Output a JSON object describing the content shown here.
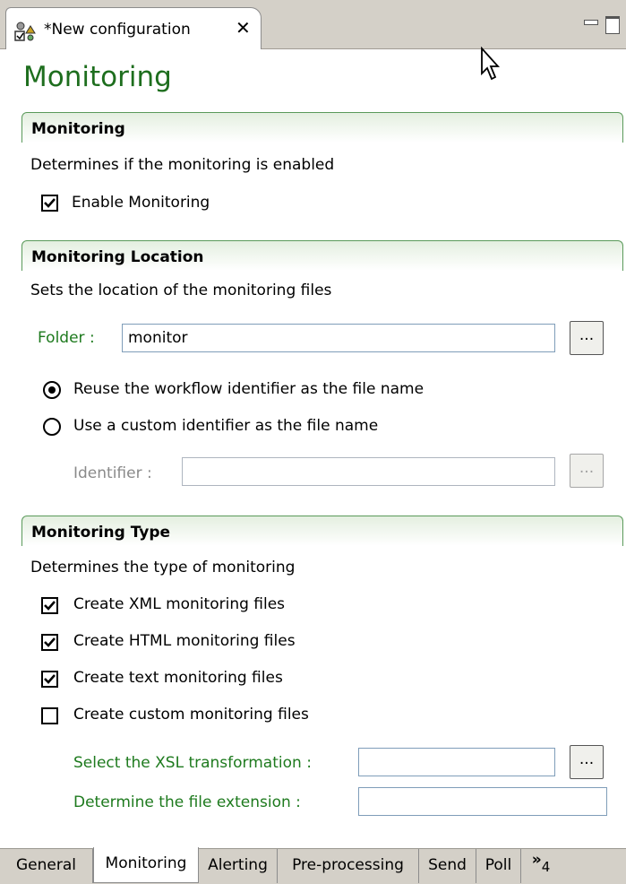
{
  "editor_tab": {
    "title": "*New configuration",
    "close": "✕"
  },
  "page": {
    "title": "Monitoring"
  },
  "monitoring": {
    "header": "Monitoring",
    "description": "Determines if the monitoring is enabled",
    "enable_label": "Enable Monitoring",
    "enable_checked": true
  },
  "location": {
    "header": "Monitoring Location",
    "description": "Sets the location of the monitoring files",
    "folder_label": "Folder :",
    "folder_value": "monitor",
    "browse": "...",
    "radio_reuse": "Reuse the workflow identifier as the file name",
    "radio_custom": "Use a custom identifier as the file name",
    "identifier_label": "Identifier :",
    "identifier_value": ""
  },
  "type": {
    "header": "Monitoring Type",
    "description": "Determines the type of monitoring",
    "xml": "Create XML monitoring files",
    "html": "Create HTML monitoring files",
    "text": "Create text monitoring files",
    "custom": "Create custom monitoring files",
    "xsl_label": "Select the XSL transformation :",
    "ext_label": "Determine the file extension   :",
    "xsl_value": "",
    "ext_value": ""
  },
  "bottom_tabs": [
    "General",
    "Monitoring",
    "Alerting",
    "Pre-processing",
    "Send",
    "Poll"
  ],
  "overflow": {
    "chevron": "»",
    "count": "4"
  },
  "colors": {
    "title_green": "#1e6e1e",
    "label_green": "#1e7a1e",
    "chrome": "#d4d0c8"
  }
}
